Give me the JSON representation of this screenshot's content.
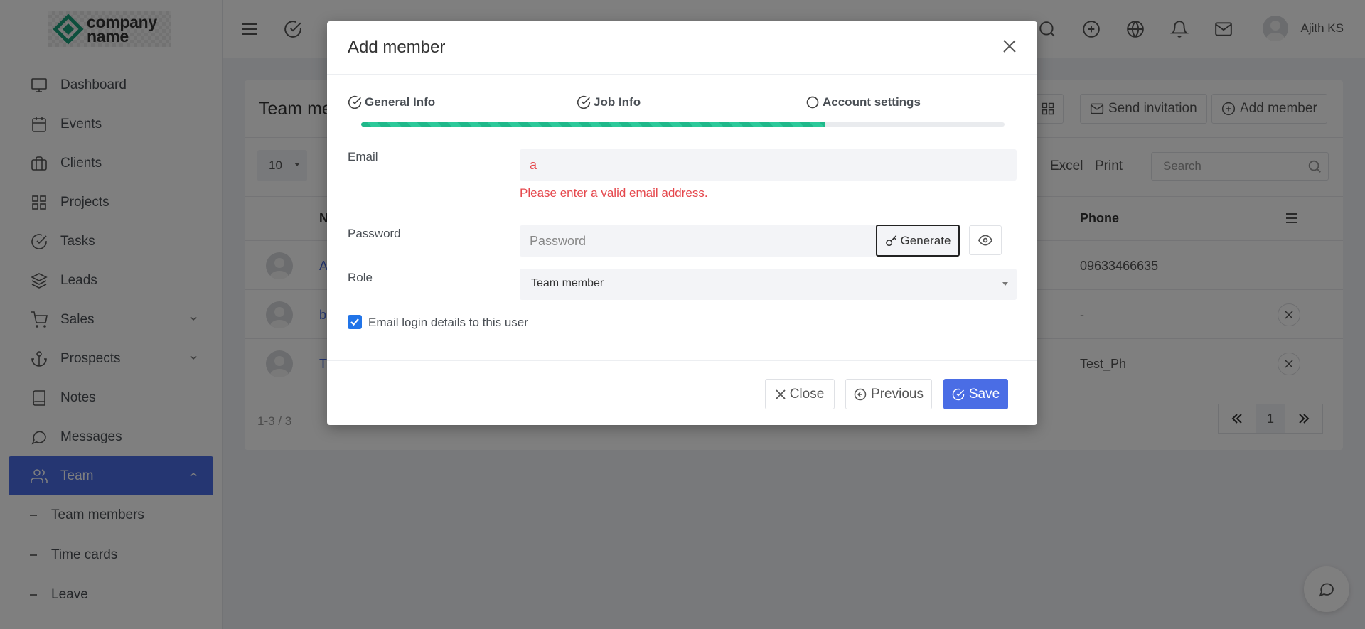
{
  "brand": {
    "line1": "company",
    "line2": "name"
  },
  "sidebar": {
    "items": [
      {
        "label": "Dashboard",
        "icon": "monitor-icon"
      },
      {
        "label": "Events",
        "icon": "calendar-icon"
      },
      {
        "label": "Clients",
        "icon": "briefcase-icon"
      },
      {
        "label": "Projects",
        "icon": "grid-icon"
      },
      {
        "label": "Tasks",
        "icon": "check-circle-icon"
      },
      {
        "label": "Leads",
        "icon": "layers-icon"
      },
      {
        "label": "Sales",
        "icon": "cart-icon"
      },
      {
        "label": "Prospects",
        "icon": "anchor-icon"
      },
      {
        "label": "Notes",
        "icon": "book-icon"
      },
      {
        "label": "Messages",
        "icon": "chat-icon"
      },
      {
        "label": "Team",
        "icon": "users-icon"
      }
    ],
    "sub_items": [
      "Team members",
      "Time cards",
      "Leave"
    ]
  },
  "topbar": {
    "user_name": "Ajith KS"
  },
  "page": {
    "title": "Team me",
    "send_invitation": "Send invitation",
    "add_member": "Add member",
    "page_length": "10",
    "excel": "Excel",
    "print": "Print",
    "search_placeholder": "Search",
    "col_name": "N",
    "col_phone": "Phone",
    "rows": [
      {
        "name": "A",
        "phone": "09633466635"
      },
      {
        "name": "b",
        "phone": "-"
      },
      {
        "name": "T",
        "phone": "Test_Ph"
      }
    ],
    "info": "1-3 / 3",
    "current_page": "1"
  },
  "modal": {
    "title": "Add member",
    "steps": [
      "General Info",
      "Job Info",
      "Account settings"
    ],
    "progress": 0.72,
    "email_label": "Email",
    "email_value": "a",
    "email_error": "Please enter a valid email address.",
    "password_label": "Password",
    "password_placeholder": "Password",
    "generate": "Generate",
    "role_label": "Role",
    "role_value": "Team member",
    "email_login_label": "Email login details to this user",
    "close": "Close",
    "previous": "Previous",
    "save": "Save"
  },
  "colors": {
    "accent": "#4a6de5",
    "success": "#1fb88a",
    "error": "#e5484d",
    "checkbox": "#2174e8"
  }
}
